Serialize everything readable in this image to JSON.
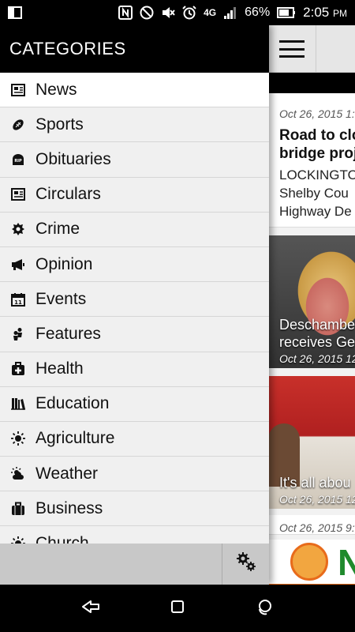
{
  "status_bar": {
    "network": "4G",
    "battery": "66%",
    "time": "2:05",
    "ampm": "PM"
  },
  "drawer": {
    "title": "CATEGORIES",
    "items": [
      {
        "label": "News",
        "icon": "newspaper-icon",
        "active": true
      },
      {
        "label": "Sports",
        "icon": "football-icon"
      },
      {
        "label": "Obituaries",
        "icon": "tombstone-icon"
      },
      {
        "label": "Circulars",
        "icon": "newspaper-icon"
      },
      {
        "label": "Crime",
        "icon": "police-badge-icon"
      },
      {
        "label": "Opinion",
        "icon": "megaphone-icon"
      },
      {
        "label": "Events",
        "icon": "calendar-icon"
      },
      {
        "label": "Features",
        "icon": "people-icon"
      },
      {
        "label": "Health",
        "icon": "medical-kit-icon"
      },
      {
        "label": "Education",
        "icon": "books-icon"
      },
      {
        "label": "Agriculture",
        "icon": "sun-icon"
      },
      {
        "label": "Weather",
        "icon": "partly-cloudy-icon"
      },
      {
        "label": "Business",
        "icon": "briefcase-icon"
      },
      {
        "label": "Church",
        "icon": "sun-icon"
      }
    ]
  },
  "feed": {
    "articles": [
      {
        "date": "Oct 26, 2015 1:",
        "headline_lines": [
          "Road to clo",
          "bridge proje"
        ],
        "snippet_lines": [
          "LOCKINGTO",
          "Shelby Cou",
          "Highway De"
        ]
      },
      {
        "caption_lines": [
          "Deschambe",
          "receives Ge"
        ],
        "date": "Oct 26, 2015 12"
      },
      {
        "caption_lines": [
          "It's all abou"
        ],
        "date": "Oct 26, 2015 12"
      },
      {
        "date": "Oct 26, 2015 9:"
      }
    ],
    "ad_text": "N"
  }
}
